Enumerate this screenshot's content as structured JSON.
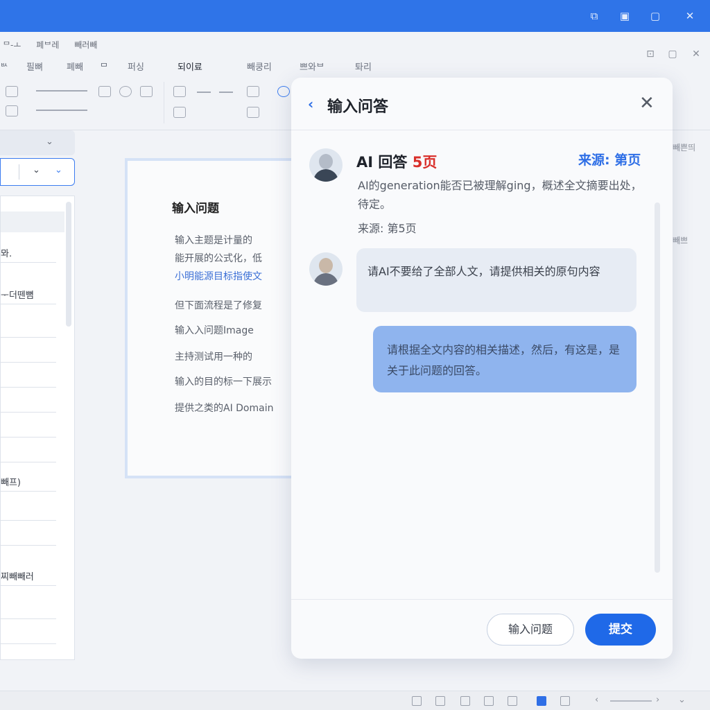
{
  "app": {
    "menu": [
      "ᄆ-ㅗ",
      "폐ᄇ레",
      "빼러빼"
    ],
    "tabs": [
      "ᄡ",
      "필뼈",
      "폐빼",
      "ᄆ",
      "퍼싱",
      "되이료",
      "빼쿵리",
      "쁘와ᄇ",
      "톼리"
    ],
    "active_tab": "되이료",
    "right_texts": [
      "빼쁜띄",
      "빼쁘"
    ]
  },
  "left_panel": {
    "items": [
      "뫄.",
      "ᅮ더뗀뼘",
      "빼프)",
      "찌빼빼러"
    ]
  },
  "slide": {
    "title": "输入问题",
    "bullets": [
      "输入主题是计量的",
      "能开展的公式化，低",
      "小明能源目标指使文",
      "但下面流程是了修复",
      "输入入问题Image",
      "主持测试用一种的",
      "输入的目的标一下展示",
      "提供之类的AI Domain"
    ]
  },
  "dialog": {
    "title": "输入问答",
    "back_icon": "chevron-left-icon",
    "close_icon": "close-icon",
    "ai_label": "AI 回答",
    "ai_page": "5页",
    "source_top": "来源: 第页",
    "ai_text": "AI的generation能否已被理解ging，概述全文摘要出处，待定。",
    "ai_source": "来源: 第5页",
    "user_question": "请AI不要给了全部人文，请提供相关的原句内容",
    "ai_reply": "请根据全文内容的相关描述，然后，有这是，是关于此问题的回答。",
    "footer": {
      "input_button": "输入问题",
      "submit_button": "提交"
    }
  },
  "colors": {
    "titlebar": "#2f74e8",
    "accent": "#1f69e8",
    "bubble_user": "#8fb4ee",
    "page_red": "#d9302b"
  }
}
